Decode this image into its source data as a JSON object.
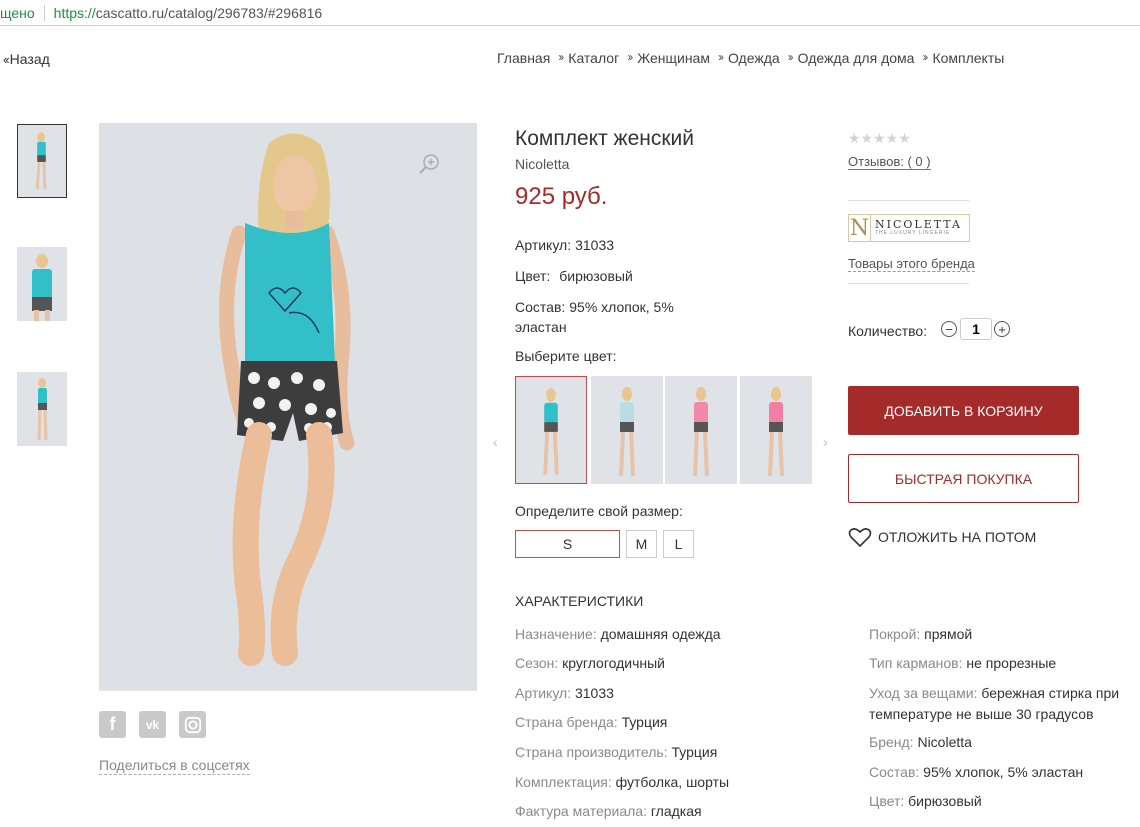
{
  "address_bar": {
    "secure_text": "щено",
    "url_scheme": "https://",
    "url_rest": "cascatto.ru/catalog/296783/#296816"
  },
  "nav": {
    "back": "Назад",
    "breadcrumbs": [
      "Главная",
      "Каталог",
      "Женщинам",
      "Одежда",
      "Одежда для дома",
      "Комплекты"
    ]
  },
  "product": {
    "title": "Комплект женский",
    "brand": "Nicoletta",
    "price": "925 руб.",
    "article_label": "Артикул:",
    "article_value": "31033",
    "color_label": "Цвет:",
    "color_value": "бирюзовый",
    "composition_label": "Состав:",
    "composition_value_1": "95% хлопок, 5%",
    "composition_value_2": "эластан",
    "choose_color": "Выберите цвет:",
    "color_swatches": [
      {
        "name": "turquoise",
        "color": "#33bfc8"
      },
      {
        "name": "light-blue",
        "color": "#b9dde2"
      },
      {
        "name": "pink",
        "color": "#f08aa8"
      },
      {
        "name": "rose",
        "color": "#f07ea6"
      }
    ],
    "size_label": "Определите свой размер:",
    "sizes": [
      "S",
      "M",
      "L"
    ],
    "selected_size": "S"
  },
  "social": {
    "icons": [
      "facebook-icon",
      "vk-icon",
      "instagram-icon"
    ],
    "share": "Поделиться в соцсетях"
  },
  "characteristics": {
    "title": "ХАРАКТЕРИСТИКИ",
    "left": [
      {
        "k": "Назначение:",
        "v": "домашняя одежда"
      },
      {
        "k": "Сезон:",
        "v": "круглогодичный"
      },
      {
        "k": "Артикул:",
        "v": "31033"
      },
      {
        "k": "Страна бренда:",
        "v": "Турция"
      },
      {
        "k": "Страна производитель:",
        "v": "Турция"
      },
      {
        "k": "Комплектация:",
        "v": "футболка, шорты"
      },
      {
        "k": "Фактура материала:",
        "v": "гладкая"
      }
    ],
    "right": [
      {
        "k": "Покрой:",
        "v": "прямой"
      },
      {
        "k": "Тип карманов:",
        "v": "не прорезные"
      },
      {
        "k": "Уход за вещами:",
        "v": "бережная стирка при",
        "v2": "температуре не выше 30 градусов"
      },
      {
        "k": "Бренд:",
        "v": "Nicoletta"
      },
      {
        "k": "Состав:",
        "v": "95% хлопок, 5% эластан"
      },
      {
        "k": "Цвет:",
        "v": "бирюзовый"
      }
    ]
  },
  "sidebar": {
    "stars": "★★★★★",
    "rating": 0,
    "reviews": "Отзывов: ( 0 )",
    "brand_logo_letter": "N",
    "brand_logo_name": "NICOLETTA",
    "brand_logo_tagline": "THE LUXURY LINGERIE",
    "brand_goods": "Товары этого бренда",
    "qty_label": "Количество:",
    "qty_value": "1",
    "add_to_cart": "ДОБАВИТЬ В КОРЗИНУ",
    "quick_buy": "БЫСТРАЯ ПОКУПКА",
    "save_later": "ОТЛОЖИТЬ НА ПОТОМ"
  },
  "colors": {
    "accent": "#a52a2a",
    "turquoise": "#33bfc8"
  }
}
